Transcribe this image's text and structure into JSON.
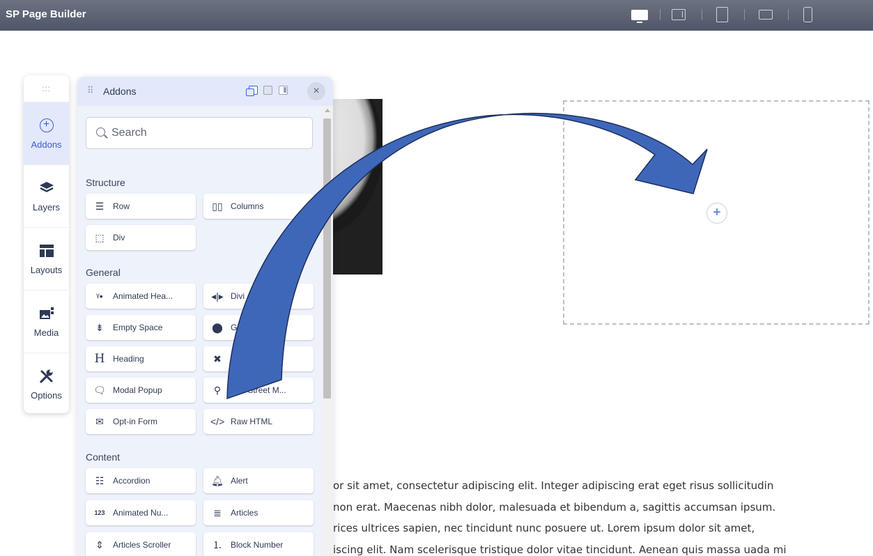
{
  "topbar": {
    "title": "SP Page Builder",
    "devices": [
      "desktop-icon",
      "laptop-icon",
      "tablet-icon",
      "tablet-landscape-icon",
      "mobile-icon"
    ],
    "active_device": "desktop"
  },
  "sidebar": {
    "grip": ":::",
    "items": [
      {
        "label": "Addons",
        "icon": "plus-circle-icon",
        "active": true
      },
      {
        "label": "Layers",
        "icon": "layers-icon"
      },
      {
        "label": "Layouts",
        "icon": "layout-icon"
      },
      {
        "label": "Media",
        "icon": "media-icon"
      },
      {
        "label": "Options",
        "icon": "tools-icon"
      }
    ]
  },
  "panel": {
    "title": "Addons",
    "grip": "⠿",
    "close": "×",
    "search": {
      "placeholder": "Search"
    },
    "sections": {
      "structure": "Structure",
      "general": "General",
      "content": "Content"
    },
    "addons": {
      "row": "Row",
      "columns": "Columns",
      "div": "Div",
      "animated_heading": "Animated Hea...",
      "divider": "Divi",
      "empty_space": "Empty Space",
      "map": "G",
      "heading": "Heading",
      "module": "ule",
      "modal_popup": "Modal Popup",
      "osm": "O",
      "osm_tail": "Street M...",
      "optin_form": "Opt-in Form",
      "raw_html": "Raw HTML",
      "accordion": "Accordion",
      "alert": "Alert",
      "animated_number": "Animated Nu...",
      "articles": "Articles",
      "articles_scroller": "Articles Scroller",
      "block_number": "Block Number"
    }
  },
  "canvas": {
    "add_symbol": "+",
    "body_lines": [
      "or sit amet, consectetur adipiscing elit. Integer adipiscing erat eget risus sollicitudin",
      "non erat. Maecenas nibh dolor, malesuada et bibendum a, sagittis accumsan ipsum.",
      "rices ultrices sapien, nec tincidunt nunc posuere ut. Lorem ipsum dolor sit amet,",
      "iscing elit. Nam scelerisque tristique dolor vitae tincidunt. Aenean quis massa uada mi"
    ]
  },
  "colors": {
    "accent": "#3b5fcf",
    "annotation_arrow": "#3f67b9"
  }
}
